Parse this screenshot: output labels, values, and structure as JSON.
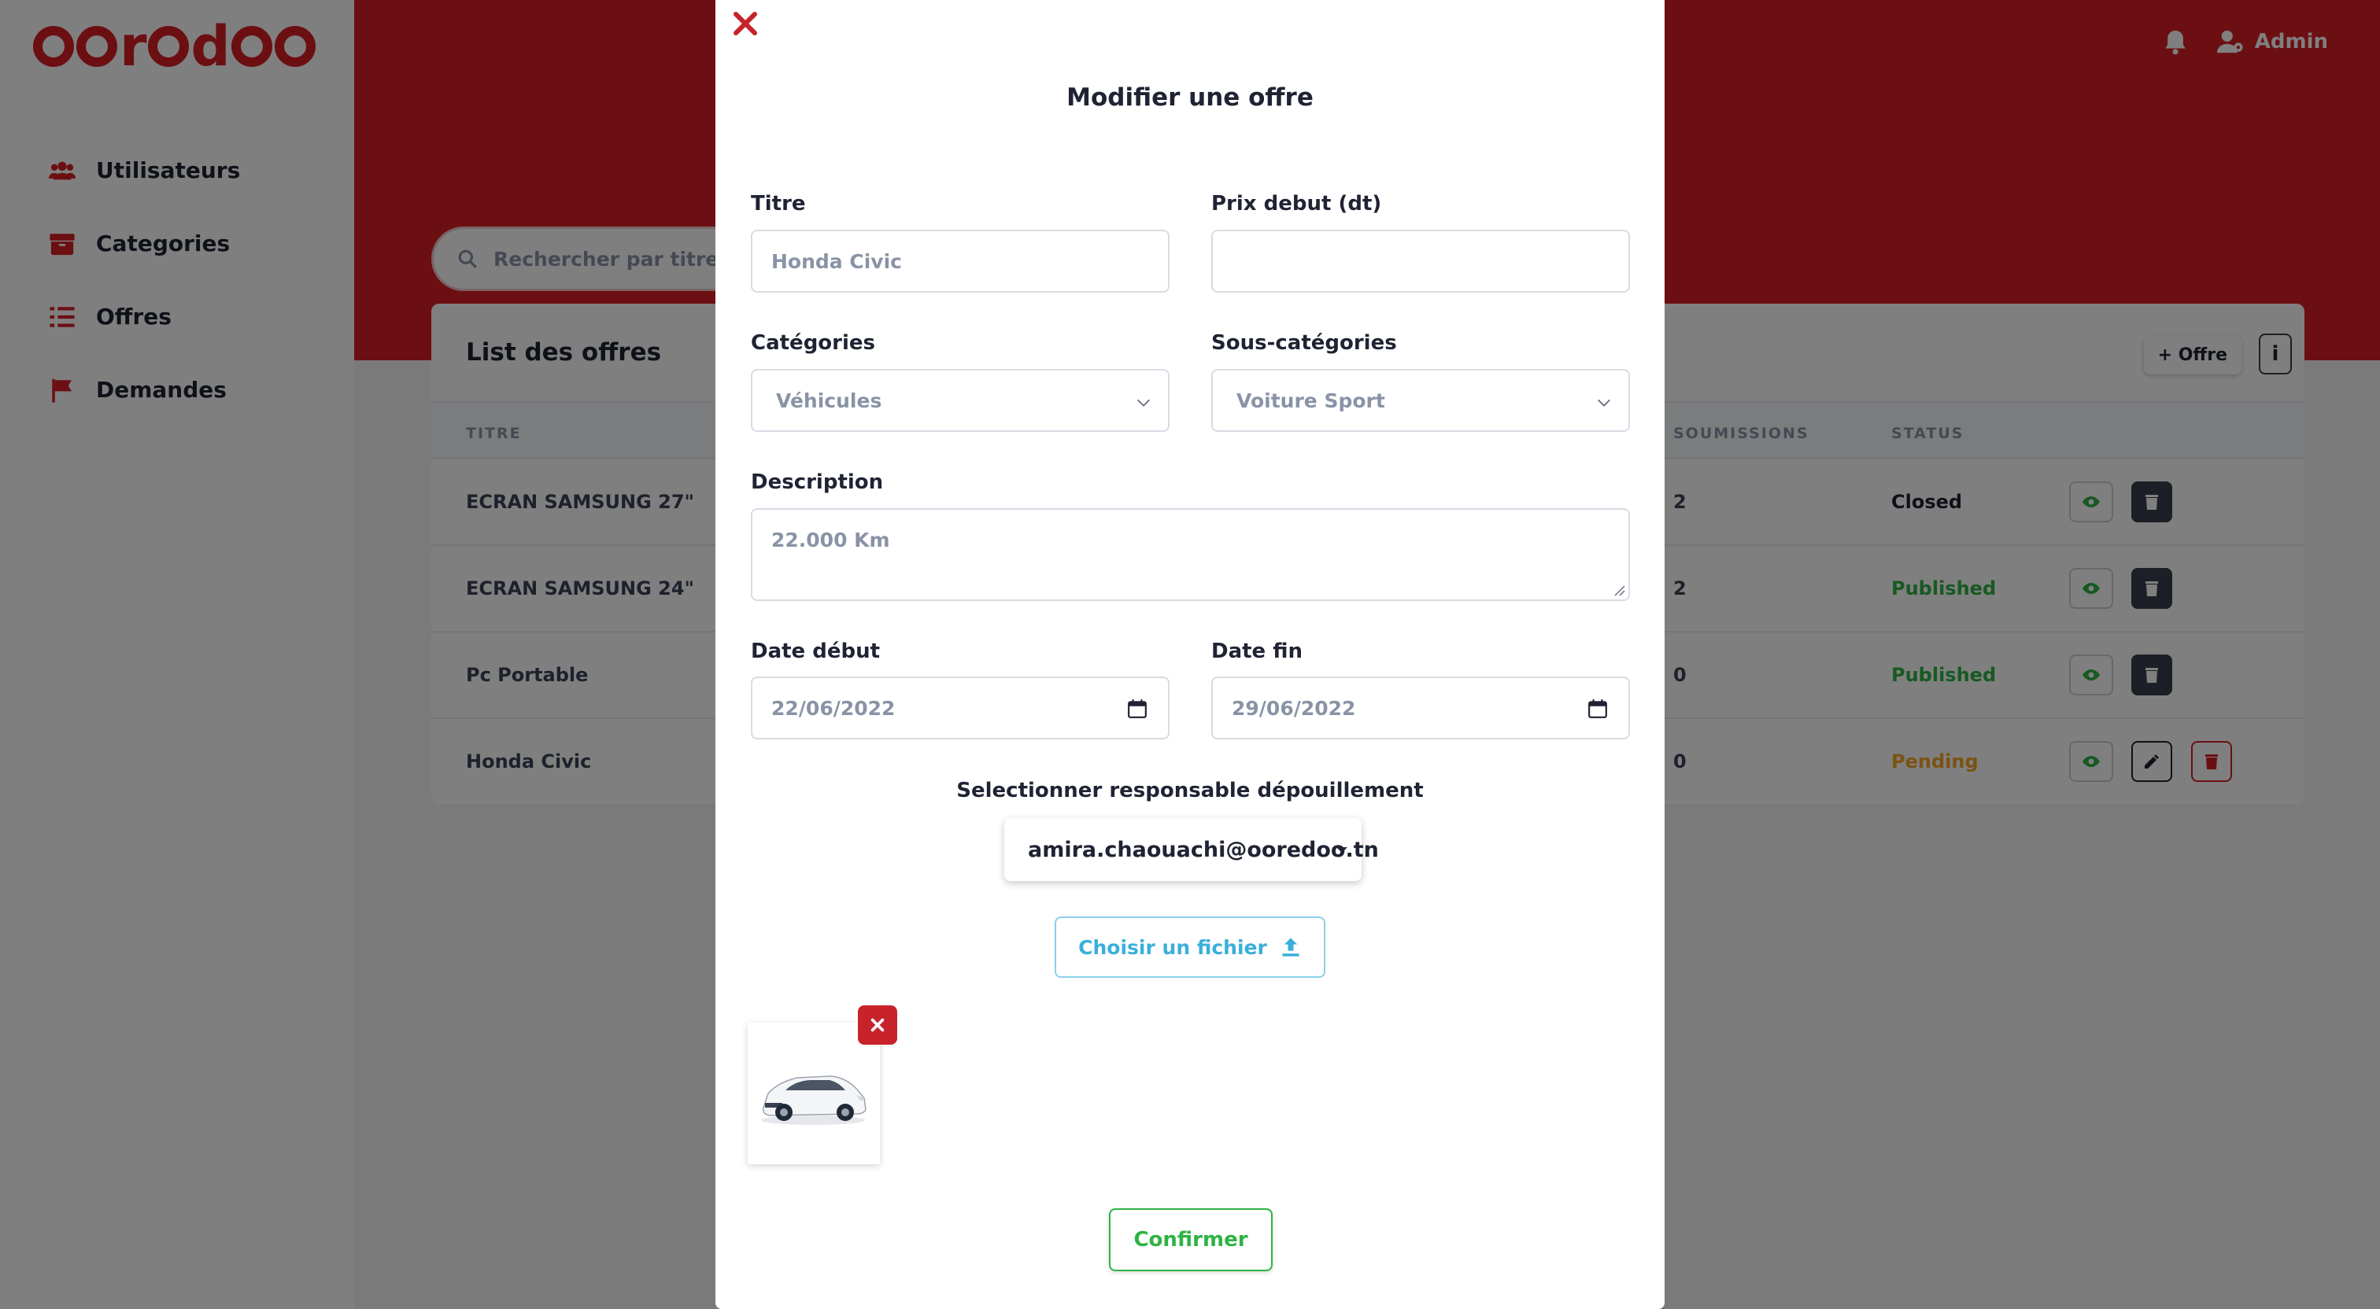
{
  "sidebar": {
    "brand": "ooredoo",
    "items": [
      {
        "label": "Utilisateurs",
        "icon": "users-icon"
      },
      {
        "label": "Categories",
        "icon": "archive-icon"
      },
      {
        "label": "Offres",
        "icon": "list-icon"
      },
      {
        "label": "Demandes",
        "icon": "flag-icon"
      }
    ]
  },
  "topbar": {
    "user": "Admin"
  },
  "search": {
    "placeholder": "Rechercher par titre"
  },
  "card": {
    "title": "List des offres",
    "add_label": "Offre",
    "info_label": "i",
    "columns": {
      "titre": "TITRE",
      "soumissions": "SOUMISSIONS",
      "status": "STATUS"
    },
    "rows": [
      {
        "titre": "ECRAN SAMSUNG 27\"",
        "soumissions": "2",
        "status": "Closed"
      },
      {
        "titre": "ECRAN SAMSUNG 24\"",
        "soumissions": "2",
        "status": "Published"
      },
      {
        "titre": "Pc Portable",
        "soumissions": "0",
        "status": "Published"
      },
      {
        "titre": "Honda Civic",
        "soumissions": "0",
        "status": "Pending"
      }
    ]
  },
  "modal": {
    "title": "Modifier une offre",
    "titre_label": "Titre",
    "titre_value": "Honda Civic",
    "prix_label": "Prix debut (dt)",
    "prix_value": "",
    "categories_label": "Catégories",
    "categories_value": "Véhicules",
    "souscat_label": "Sous-catégories",
    "souscat_value": "Voiture Sport",
    "description_label": "Description",
    "description_value": "22.000 Km",
    "date_debut_label": "Date début",
    "date_debut_value": "22/06/2022",
    "date_fin_label": "Date fin",
    "date_fin_value": "29/06/2022",
    "responsable_label": "Selectionner responsable dépouillement",
    "responsable_value": "amira.chaouachi@ooredoo.tn",
    "file_button": "Choisir un fichier",
    "confirm_button": "Confirmer"
  },
  "colors": {
    "brand": "#d91f26",
    "published": "#2fb344",
    "pending": "#f5a623",
    "file_button": "#3aafd9"
  }
}
